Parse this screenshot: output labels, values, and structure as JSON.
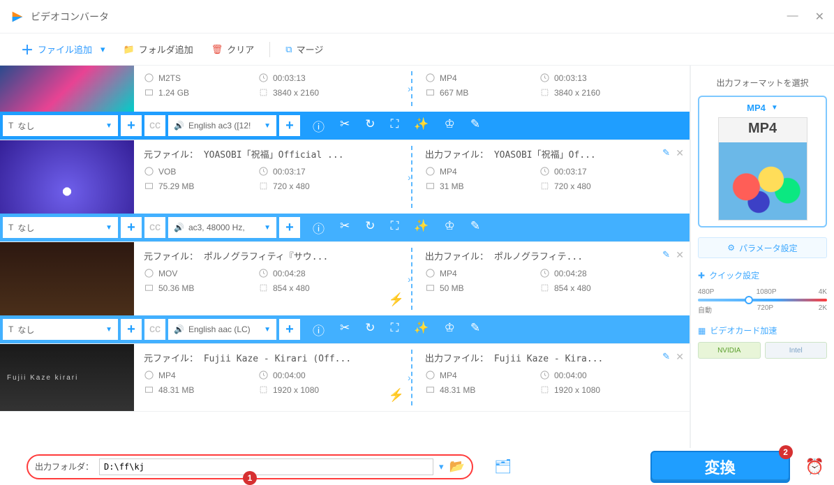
{
  "window": {
    "title": "ビデオコンバータ"
  },
  "toolbar": {
    "addFile": "ファイル追加",
    "addFolder": "フォルダ追加",
    "clear": "クリア",
    "merge": "マージ"
  },
  "items": [
    {
      "src": {
        "format": "M2TS",
        "duration": "00:03:13",
        "size": "1.24 GB",
        "res": "3840 x 2160"
      },
      "out": {
        "format": "MP4",
        "duration": "00:03:13",
        "size": "667 MB",
        "res": "3840 x 2160"
      },
      "sub": "なし",
      "audio": "English ac3 ([12!"
    },
    {
      "srcName": "元ファイル： YOASOBI「祝福」Official ...",
      "outName": "出力ファイル： YOASOBI「祝福」Of...",
      "src": {
        "format": "VOB",
        "duration": "00:03:17",
        "size": "75.29 MB",
        "res": "720 x 480"
      },
      "out": {
        "format": "MP4",
        "duration": "00:03:17",
        "size": "31 MB",
        "res": "720 x 480"
      },
      "sub": "なし",
      "audio": "ac3, 48000 Hz,"
    },
    {
      "srcName": "元ファイル： ポルノグラフィティ『サウ...",
      "outName": "出力ファイル： ポルノグラフィテ...",
      "src": {
        "format": "MOV",
        "duration": "00:04:28",
        "size": "50.36 MB",
        "res": "854 x 480"
      },
      "out": {
        "format": "MP4",
        "duration": "00:04:28",
        "size": "50 MB",
        "res": "854 x 480"
      },
      "sub": "なし",
      "audio": "English aac (LC)"
    },
    {
      "srcName": "元ファイル： Fujii Kaze - Kirari (Off...",
      "outName": "出力ファイル： Fujii Kaze - Kira...",
      "src": {
        "format": "MP4",
        "duration": "00:04:00",
        "size": "48.31 MB",
        "res": "1920 x 1080"
      },
      "out": {
        "format": "MP4",
        "duration": "00:04:00",
        "size": "48.31 MB",
        "res": "1920 x 1080"
      }
    }
  ],
  "sidebar": {
    "title": "出力フォーマットを選択",
    "format": "MP4",
    "paramBtn": "パラメータ設定",
    "quick": "クイック設定",
    "resTop": [
      "480P",
      "1080P",
      "4K"
    ],
    "resBottom": [
      "自動",
      "720P",
      "2K"
    ],
    "gpu": "ビデオカード加速",
    "nvidia": "NVIDIA",
    "intel": "Intel"
  },
  "footer": {
    "outLabel": "出力フォルダ：",
    "outPath": "D:\\ff\\kj",
    "convert": "変換"
  },
  "thumbText": "Fujii Kaze kirari"
}
